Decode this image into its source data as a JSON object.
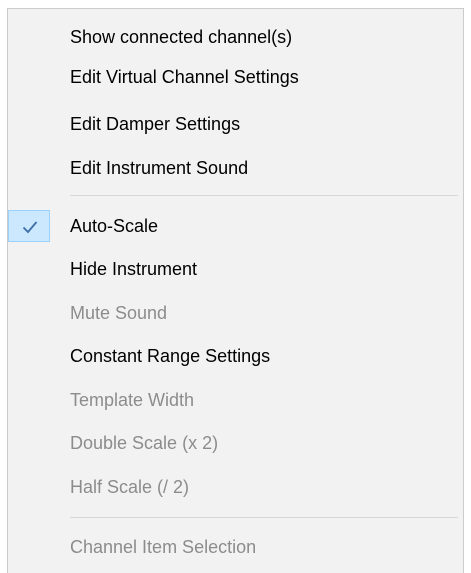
{
  "menu": {
    "group1": [
      {
        "label": "Show connected channel(s)",
        "enabled": true
      },
      {
        "label": "Edit Virtual Channel Settings",
        "enabled": true
      },
      {
        "label": "Edit Damper Settings",
        "enabled": true
      },
      {
        "label": "Edit Instrument Sound",
        "enabled": true
      }
    ],
    "group2": [
      {
        "label": "Auto-Scale",
        "enabled": true,
        "checked": true
      },
      {
        "label": "Hide Instrument",
        "enabled": true
      },
      {
        "label": "Mute Sound",
        "enabled": false
      },
      {
        "label": "Constant Range Settings",
        "enabled": true
      },
      {
        "label": "Template Width",
        "enabled": false
      },
      {
        "label": "Double Scale (x 2)",
        "enabled": false
      },
      {
        "label": "Half Scale (/ 2)",
        "enabled": false
      }
    ],
    "group3": [
      {
        "label": "Channel Item Selection",
        "enabled": false
      }
    ]
  },
  "colors": {
    "menu_background": "#f2f2f2",
    "enabled_text": "#000000",
    "disabled_text": "#8c8c8c",
    "check_highlight": "#cce8ff",
    "check_mark": "#3d6fa6"
  },
  "icons": {
    "check": "checkmark-icon"
  }
}
